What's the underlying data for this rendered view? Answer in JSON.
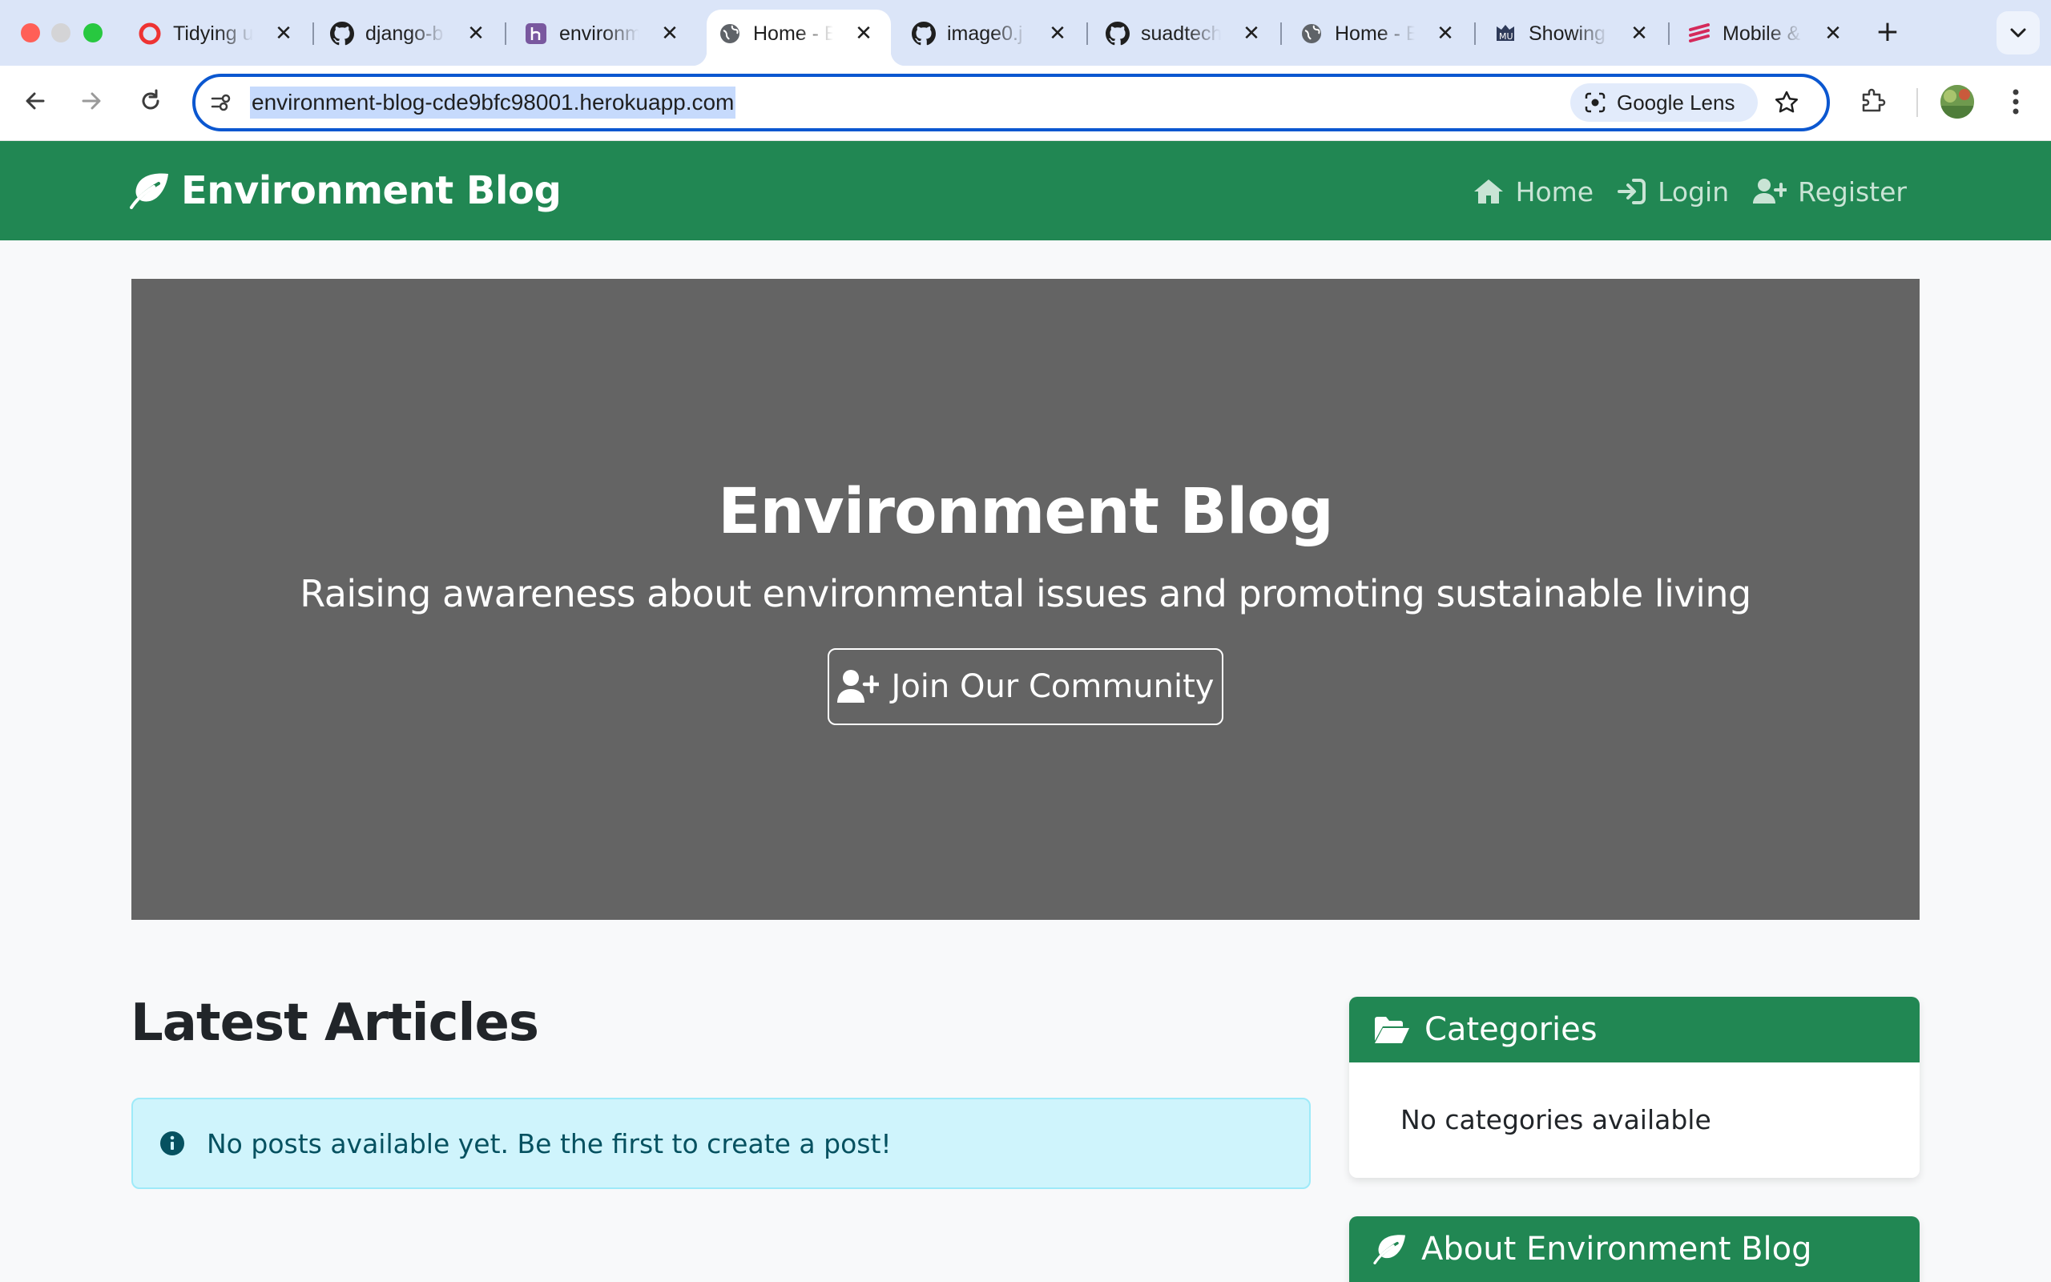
{
  "browser": {
    "tabs": [
      {
        "title": "Tidying u",
        "icon": "opera-icon",
        "active": false
      },
      {
        "title": "django-b",
        "icon": "github-icon",
        "active": false
      },
      {
        "title": "environm",
        "icon": "heroku-icon",
        "active": false
      },
      {
        "title": "Home - E",
        "icon": "globe-icon",
        "active": true
      },
      {
        "title": "image0.j",
        "icon": "github-icon",
        "active": false
      },
      {
        "title": "suadtech",
        "icon": "github-icon",
        "active": false
      },
      {
        "title": "Home - E",
        "icon": "globe-icon",
        "active": false
      },
      {
        "title": "Showing",
        "icon": "markdown-monster-icon",
        "active": false
      },
      {
        "title": "Mobile &",
        "icon": "ui-tool-icon",
        "active": false
      }
    ],
    "close_glyph": "✕",
    "new_tab_glyph": "+",
    "url": "environment-blog-cde9bfc98001.herokuapp.com",
    "lens_label": "Google Lens"
  },
  "site": {
    "brand": "Environment Blog",
    "nav": {
      "home": "Home",
      "login": "Login",
      "register": "Register"
    },
    "colors": {
      "primary": "#218753",
      "hero_bg": "#646464",
      "alert_bg": "#cff4fc",
      "alert_text": "#055160"
    }
  },
  "hero": {
    "title": "Environment Blog",
    "subtitle": "Raising awareness about environmental issues and promoting sustainable living",
    "cta": "Join Our Community"
  },
  "main": {
    "heading": "Latest Articles",
    "empty_message": "No posts available yet. Be the first to create a post!"
  },
  "sidebar": {
    "categories": {
      "title": "Categories",
      "empty": "No categories available"
    },
    "about": {
      "title": "About Environment Blog"
    }
  }
}
